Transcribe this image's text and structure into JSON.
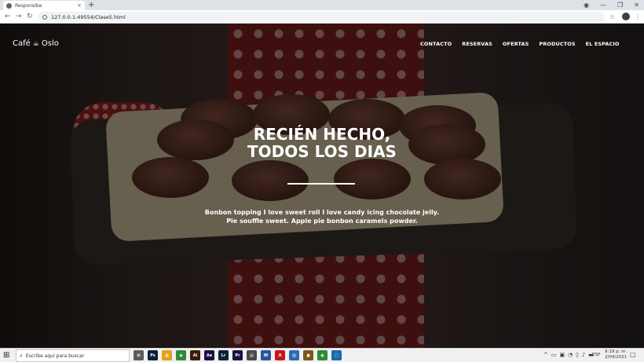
{
  "browser": {
    "tab_title": "Responsibe",
    "tab_close": "×",
    "new_tab": "+",
    "url": "127.0.0.1:49554/Clase5.html",
    "back": "←",
    "forward": "→",
    "reload": "↻",
    "star": "☆",
    "menu": "⋮",
    "window_controls": [
      "◉",
      "—",
      "❐",
      "✕"
    ]
  },
  "site": {
    "brand": "Café",
    "brand_cup": "☕",
    "brand_name": "Oslo",
    "nav": [
      "CONTACTO",
      "RESERVAS",
      "OFERTAS",
      "PRODUCTOS",
      "EL ESPACIO"
    ],
    "hero_title_line1": "RECIÉN HECHO,",
    "hero_title_line2": "TODOS LOS DIAS",
    "hero_text_line1": "Bonbon topping I love sweet roll I love candy icing chocolate jelly.",
    "hero_text_line2": "Pie souffle sweet. Apple pie bonbon caramels powder."
  },
  "taskbar": {
    "start_icon": "windows-icon",
    "search_placeholder": "Escribe aquí para buscar",
    "apps": [
      {
        "label": "⊞",
        "color": "#5a5a5a"
      },
      {
        "label": "Ps",
        "color": "#0d1f3d"
      },
      {
        "label": "▦",
        "color": "#e3a21a"
      },
      {
        "label": "◉",
        "color": "#2e8b3a"
      },
      {
        "label": "Ai",
        "color": "#3b1a08"
      },
      {
        "label": "Ae",
        "color": "#1a1040"
      },
      {
        "label": "Lr",
        "color": "#0c2236"
      },
      {
        "label": "Pr",
        "color": "#1a1040"
      },
      {
        "label": "▤",
        "color": "#4a4a4a"
      },
      {
        "label": "W",
        "color": "#2b579a"
      },
      {
        "label": "A",
        "color": "#c4161c"
      },
      {
        "label": "▥",
        "color": "#2b6cb0"
      },
      {
        "label": "●",
        "color": "#7a5a1a"
      },
      {
        "label": "◉",
        "color": "#2e8b3a"
      },
      {
        "label": "▢",
        "color": "#1a6aa8"
      }
    ],
    "tray_icons": [
      "^",
      "▭",
      "▣",
      "◔",
      "◊",
      "♪",
      "▬"
    ],
    "lang": "ESP",
    "time": "9:19 p. m.",
    "date": "2/04/2021",
    "notif": "▢"
  }
}
